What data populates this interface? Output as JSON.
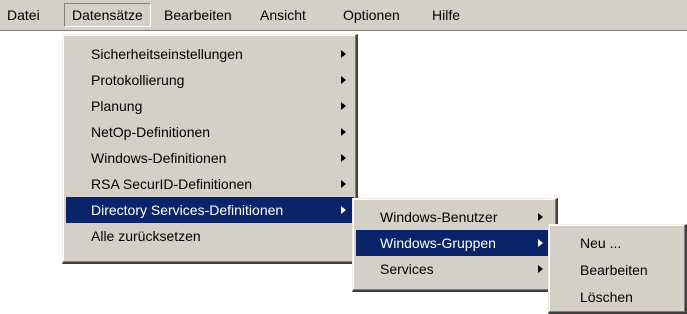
{
  "menubar": {
    "items": [
      {
        "label": "Datei"
      },
      {
        "label": "Datensätze"
      },
      {
        "label": "Bearbeiten"
      },
      {
        "label": "Ansicht"
      },
      {
        "label": "Optionen"
      },
      {
        "label": "Hilfe"
      }
    ]
  },
  "datensaetze_menu": {
    "items": [
      {
        "label": "Sicherheitseinstellungen",
        "has_submenu": true
      },
      {
        "label": "Protokollierung",
        "has_submenu": true
      },
      {
        "label": "Planung",
        "has_submenu": true
      },
      {
        "label": "NetOp-Definitionen",
        "has_submenu": true
      },
      {
        "label": "Windows-Definitionen",
        "has_submenu": true
      },
      {
        "label": "RSA SecurID-Definitionen",
        "has_submenu": true
      },
      {
        "label": "Directory Services-Definitionen",
        "has_submenu": true,
        "highlighted": true
      },
      {
        "label": "Alle zurücksetzen",
        "has_submenu": false
      }
    ]
  },
  "directory_services_menu": {
    "items": [
      {
        "label": "Windows-Benutzer",
        "has_submenu": true
      },
      {
        "label": "Windows-Gruppen",
        "has_submenu": true,
        "highlighted": true
      },
      {
        "label": "Services",
        "has_submenu": true
      }
    ]
  },
  "windows_gruppen_menu": {
    "items": [
      {
        "label": "Neu ..."
      },
      {
        "label": "Bearbeiten"
      },
      {
        "label": "Löschen"
      }
    ]
  },
  "colors": {
    "menu_face": "#d4d0c8",
    "highlight": "#0a246a",
    "highlight_text": "#ffffff"
  }
}
